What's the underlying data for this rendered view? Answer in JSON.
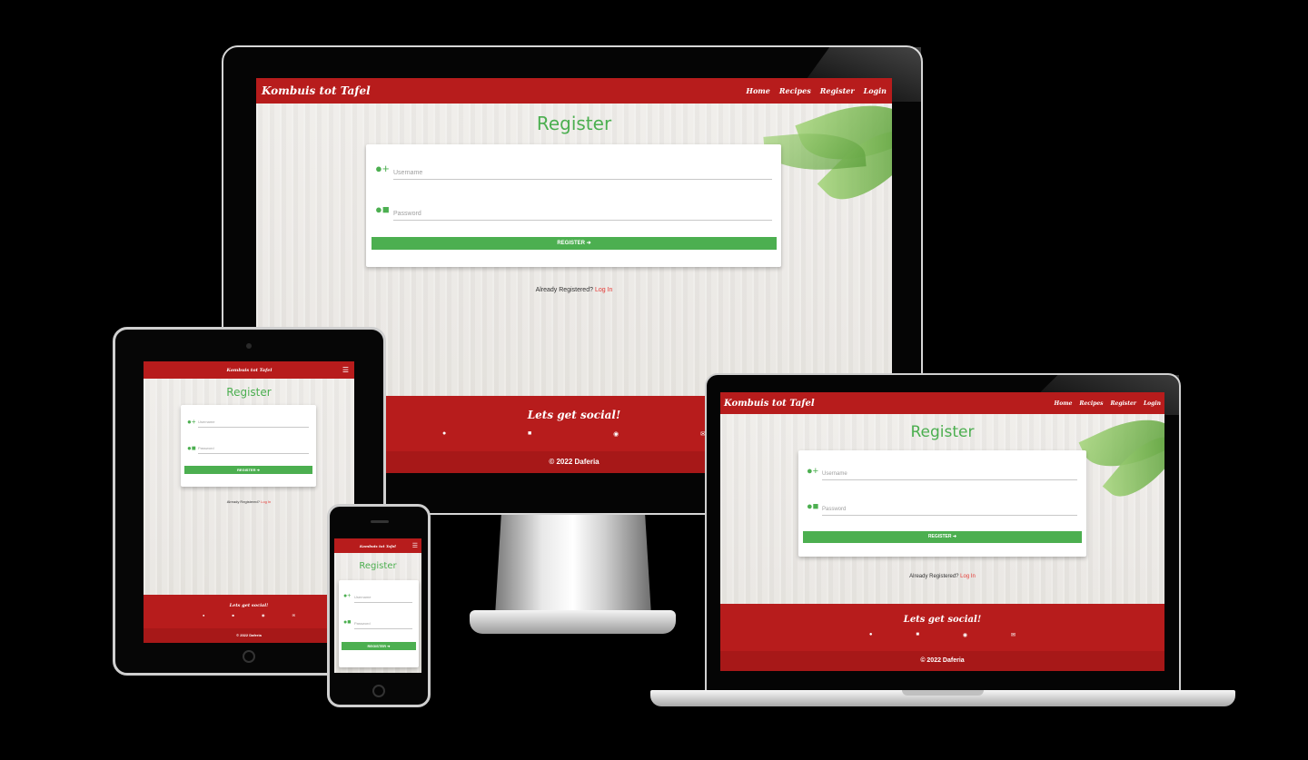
{
  "site": {
    "brand": "Kombuis tot Tafel",
    "nav": [
      "Home",
      "Recipes",
      "Register",
      "Login"
    ],
    "page_title": "Register",
    "username_placeholder": "Username",
    "password_placeholder": "Password",
    "register_button": "REGISTER",
    "already_text": "Already Registered?",
    "login_link": "Log In",
    "social_title": "Lets get social!",
    "copyright": "© 2022 Daferia"
  },
  "icons": {
    "menu": "hamburger-menu-icon",
    "user_add": "user-plus-icon",
    "user_lock": "user-lock-icon",
    "sign_in": "sign-in-icon",
    "social": [
      "facebook-icon",
      "instagram-icon",
      "pinterest-icon",
      "email-icon"
    ]
  },
  "colors": {
    "brand_red": "#b71c1c",
    "accent_green": "#4caf50",
    "link_red": "#e53935",
    "backdrop": "#000000"
  }
}
